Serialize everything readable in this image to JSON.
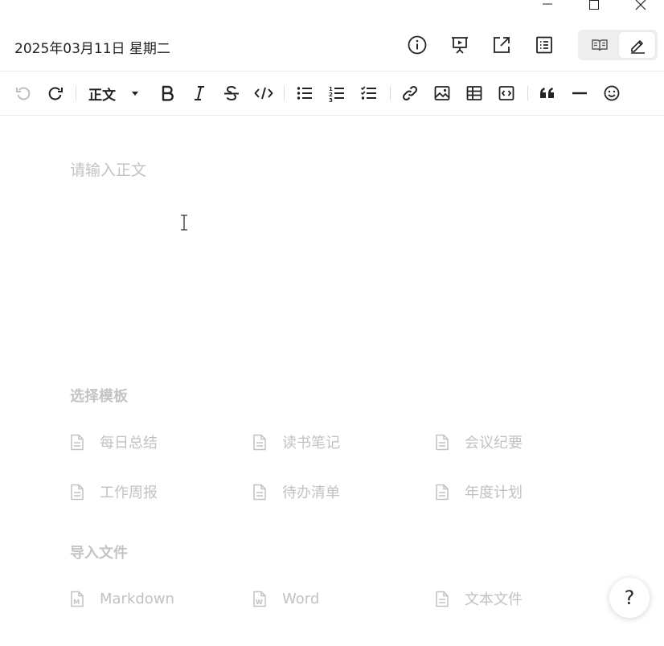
{
  "header": {
    "date_title": "2025年03月11日 星期二",
    "icons": [
      "info-icon",
      "presentation-icon",
      "share-icon",
      "outline-icon"
    ],
    "mode_switch": {
      "read_icon": "book-icon",
      "edit_icon": "pencil-icon",
      "active": "edit"
    }
  },
  "window": {
    "controls": [
      "minimize-icon",
      "maximize-icon",
      "close-icon"
    ]
  },
  "toolbar": {
    "paragraph_style": "正文",
    "items": [
      "undo-icon",
      "redo-icon",
      "bold-icon",
      "italic-icon",
      "strikethrough-icon",
      "code-icon",
      "bullet-list-icon",
      "numbered-list-icon",
      "checklist-icon",
      "link-icon",
      "image-icon",
      "table-icon",
      "code-block-icon",
      "quote-icon",
      "divider-icon",
      "emoji-icon"
    ]
  },
  "editor": {
    "placeholder": "请输入正文"
  },
  "templates": {
    "title": "选择模板",
    "items": [
      {
        "label": "每日总结",
        "icon": "document-icon"
      },
      {
        "label": "读书笔记",
        "icon": "document-icon"
      },
      {
        "label": "会议纪要",
        "icon": "document-icon"
      },
      {
        "label": "工作周报",
        "icon": "document-icon"
      },
      {
        "label": "待办清单",
        "icon": "document-icon"
      },
      {
        "label": "年度计划",
        "icon": "document-icon"
      }
    ]
  },
  "import": {
    "title": "导入文件",
    "items": [
      {
        "label": "Markdown",
        "icon": "markdown-file-icon",
        "badge": "M"
      },
      {
        "label": "Word",
        "icon": "word-file-icon",
        "badge": "W"
      },
      {
        "label": "文本文件",
        "icon": "text-file-icon"
      }
    ]
  },
  "help": {
    "label": "?"
  },
  "colors": {
    "text": "#222222",
    "muted": "#c2c2c2",
    "divider": "#ebebeb",
    "switch_bg": "#eeeeee"
  }
}
